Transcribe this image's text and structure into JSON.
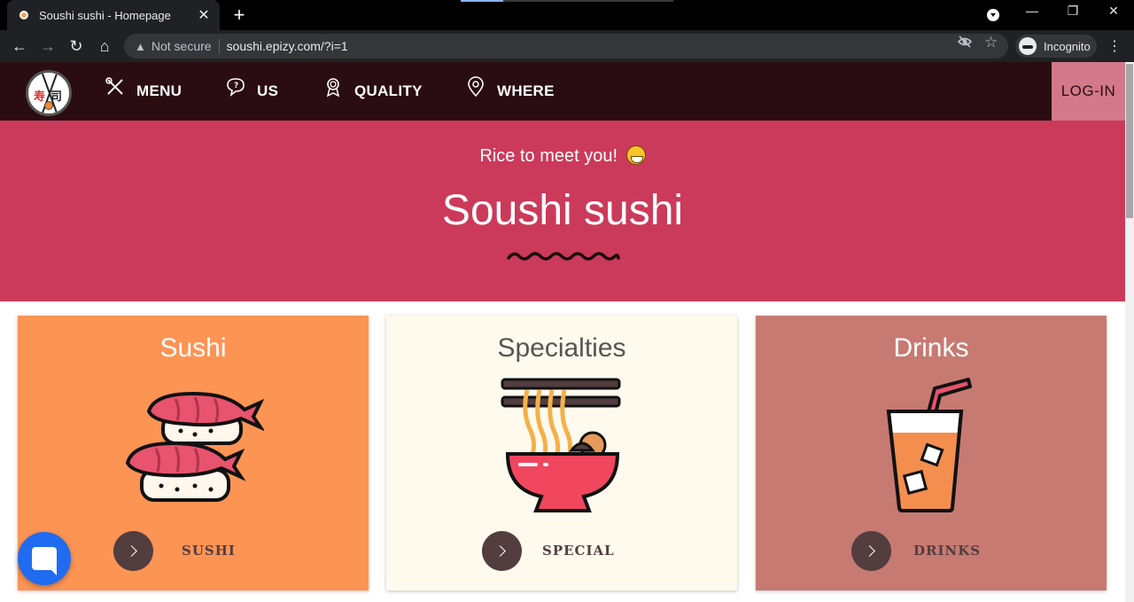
{
  "browser": {
    "tab_title": "Soushi sushi - Homepage",
    "new_tab_symbol": "+",
    "security_label": "Not secure",
    "url": "soushi.epizy.com/?i=1",
    "profile_label": "Incognito",
    "icons": [
      "favicon",
      "close-icon",
      "minimize-icon",
      "restore-icon",
      "window-close-icon",
      "back-icon",
      "forward-icon",
      "reload-icon",
      "home-icon",
      "warning-icon",
      "eye-off-icon",
      "star-icon",
      "incognito-icon",
      "kebab-menu-icon"
    ]
  },
  "nav": {
    "logo_chars": [
      "寿",
      "司"
    ],
    "items": [
      {
        "label": "MENU",
        "icon": "utensils-icon"
      },
      {
        "label": "US",
        "icon": "chat-bubble-icon"
      },
      {
        "label": "QUALITY",
        "icon": "award-icon"
      },
      {
        "label": "WHERE",
        "icon": "map-pin-icon"
      }
    ],
    "login": "LOG-IN"
  },
  "hero": {
    "greeting": "Rice to meet you!",
    "emoji": "grinning-face-icon",
    "brand": "Soushi sushi"
  },
  "cards": [
    {
      "title": "Sushi",
      "button_label": "SUSHI",
      "bg": "#fc9454",
      "title_color": "#ffffff",
      "illustration": "sushi-icon"
    },
    {
      "title": "Specialties",
      "button_label": "SPECIAL",
      "bg": "#fffaed",
      "title_color": "#555555",
      "illustration": "ramen-bowl-icon"
    },
    {
      "title": "Drinks",
      "button_label": "DRINKS",
      "bg": "#c77a72",
      "title_color": "#ffffff",
      "illustration": "drink-glass-icon"
    }
  ],
  "colors": {
    "nav_bg": "#2a0d12",
    "hero_bg": "#cb3a5a",
    "login_bg": "#d3788a",
    "button_dark": "#523d3f",
    "chat_blue": "#1f6cf0"
  }
}
